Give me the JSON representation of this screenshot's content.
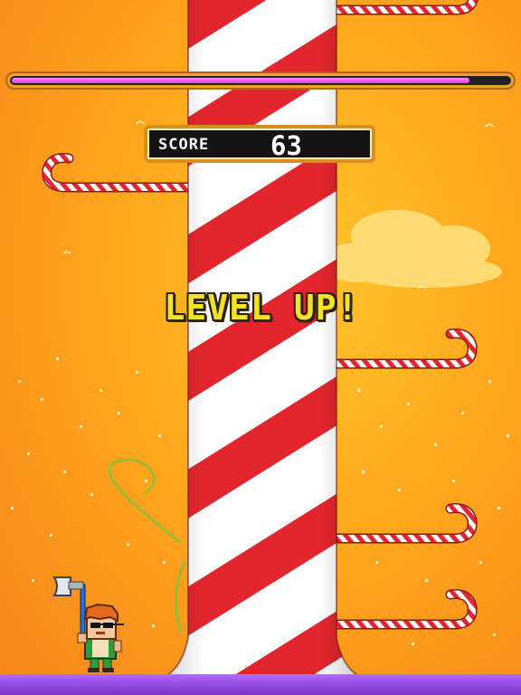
{
  "hud": {
    "score_label": "SCORE",
    "score_value": "63",
    "timer_level": 0.92
  },
  "banner": {
    "text": "LEVEL UP!"
  },
  "scene": {
    "trunk": "candy-cane-pole",
    "branches": [
      {
        "side": "right"
      },
      {
        "side": "left"
      },
      {
        "side": "right"
      },
      {
        "side": "right"
      },
      {
        "side": "right"
      }
    ],
    "player": "lumberjack-with-axe",
    "player_side": "left"
  },
  "colors": {
    "sky": "#ffa71c",
    "timer_fill": "#d93ed9",
    "candy_red": "#e3262d",
    "ground": "#9a4fe6",
    "banner_text": "#f2e22c"
  }
}
